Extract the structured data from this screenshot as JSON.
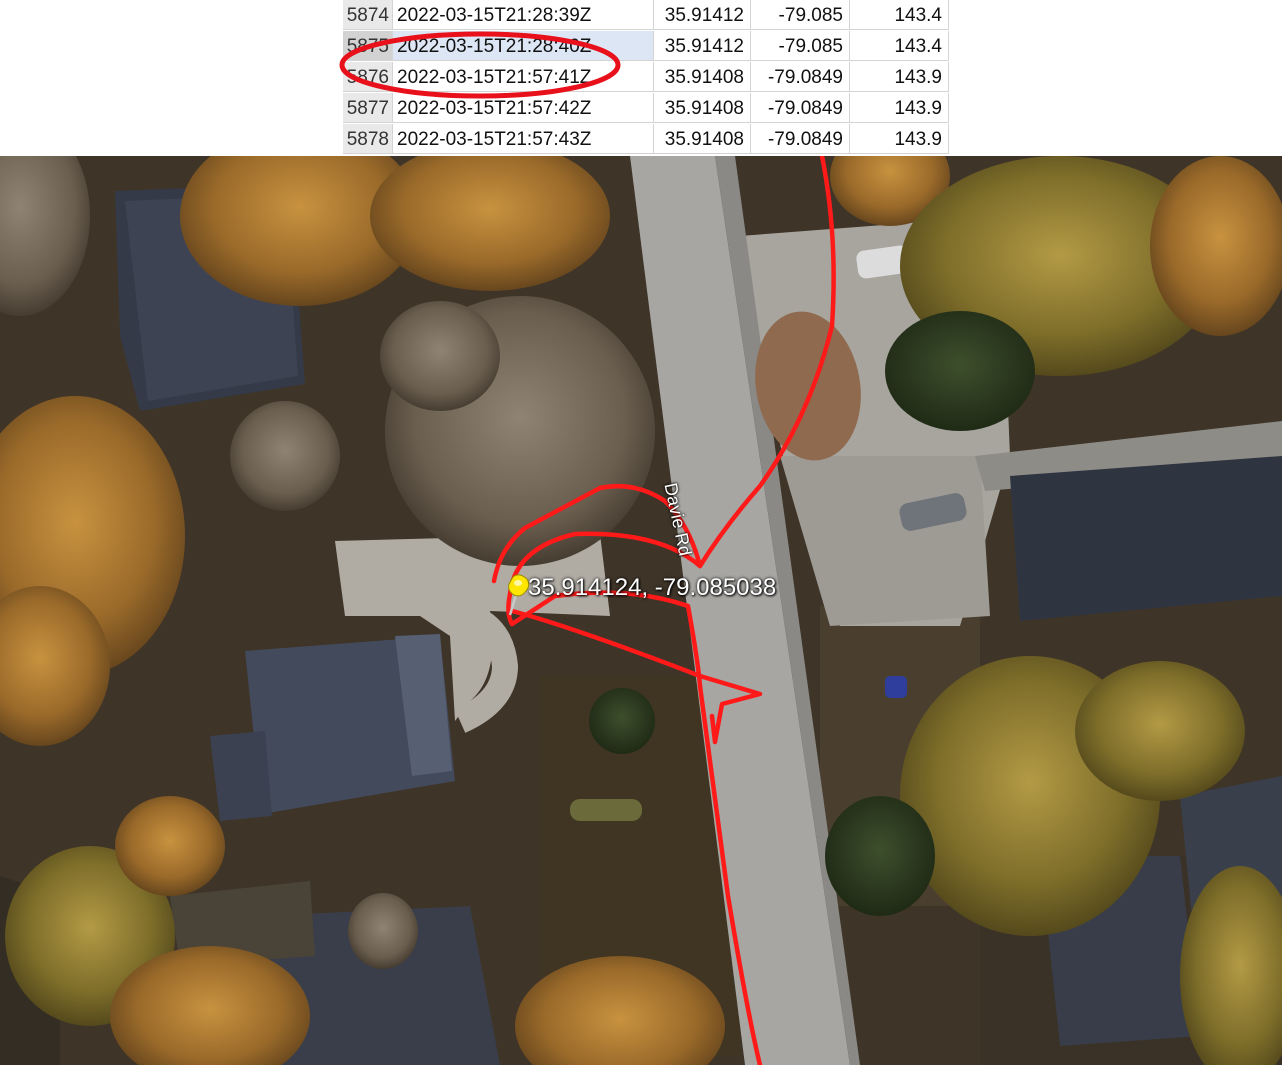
{
  "spreadsheet": {
    "rows": [
      {
        "index": "5874",
        "timestamp": "2022-03-15T21:28:39Z",
        "lat": "35.91412",
        "lon": "-79.085",
        "elevation": "143.4"
      },
      {
        "index": "5875",
        "timestamp": "2022-03-15T21:28:40Z",
        "lat": "35.91412",
        "lon": "-79.085",
        "elevation": "143.4"
      },
      {
        "index": "5876",
        "timestamp": "2022-03-15T21:57:41Z",
        "lat": "35.91408",
        "lon": "-79.0849",
        "elevation": "143.9"
      },
      {
        "index": "5877",
        "timestamp": "2022-03-15T21:57:42Z",
        "lat": "35.91408",
        "lon": "-79.0849",
        "elevation": "143.9"
      },
      {
        "index": "5878",
        "timestamp": "2022-03-15T21:57:43Z",
        "lat": "35.91408",
        "lon": "-79.0849",
        "elevation": "143.9"
      }
    ],
    "selected_row": "5875"
  },
  "annotation": {
    "color": "#e8101a"
  },
  "map": {
    "road_label": "Davie Rd",
    "pin_label": "35.914124, -79.085038",
    "pin_icon": "pushpin-icon",
    "track_color": "#ff1a1a",
    "pin_color": "#ffe600"
  }
}
